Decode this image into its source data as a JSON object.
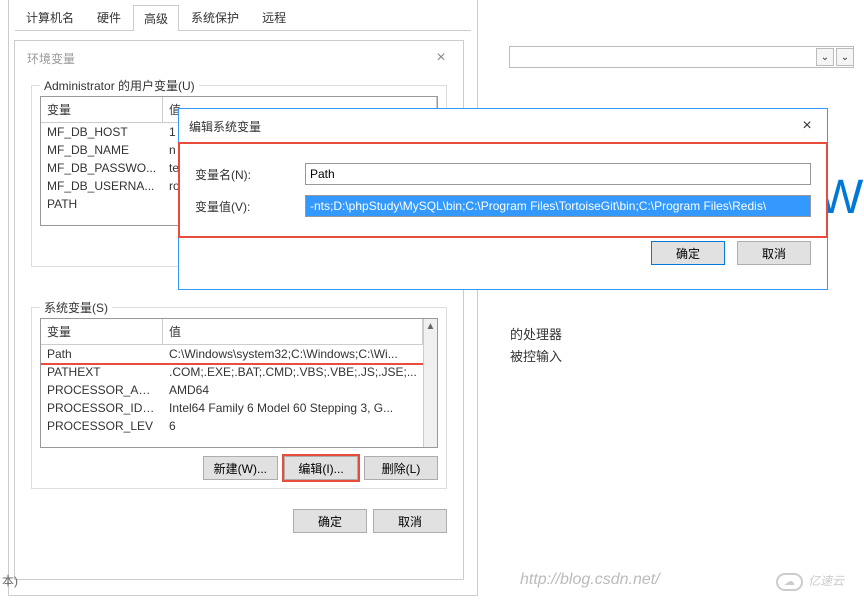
{
  "system_props_tabs": [
    "计算机名",
    "硬件",
    "高级",
    "系统保护",
    "远程"
  ],
  "active_tab_index": 2,
  "env_var_dialog": {
    "title": "环境变量",
    "user_vars": {
      "group_title": "Administrator 的用户变量(U)",
      "headers": {
        "col1": "变量",
        "col2": "值"
      },
      "rows": [
        {
          "name": "MF_DB_HOST",
          "value": "1"
        },
        {
          "name": "MF_DB_NAME",
          "value": "n"
        },
        {
          "name": "MF_DB_PASSWO...",
          "value": "te"
        },
        {
          "name": "MF_DB_USERNA...",
          "value": "ro"
        },
        {
          "name": "PATH",
          "value": ""
        }
      ]
    },
    "system_vars": {
      "group_title": "系统变量(S)",
      "headers": {
        "col1": "变量",
        "col2": "值"
      },
      "rows": [
        {
          "name": "Path",
          "value": "C:\\Windows\\system32;C:\\Windows;C:\\Wi..."
        },
        {
          "name": "PATHEXT",
          "value": ".COM;.EXE;.BAT;.CMD;.VBS;.VBE;.JS;.JSE;..."
        },
        {
          "name": "PROCESSOR_AR...",
          "value": "AMD64"
        },
        {
          "name": "PROCESSOR_IDE...",
          "value": "Intel64 Family 6 Model 60 Stepping 3, G..."
        },
        {
          "name": "PROCESSOR_LEV",
          "value": "6"
        }
      ]
    },
    "buttons": {
      "new": "新建(W)...",
      "edit": "编辑(I)...",
      "delete": "删除(L)",
      "ok": "确定",
      "cancel": "取消"
    }
  },
  "edit_dialog": {
    "title": "编辑系统变量",
    "name_label": "变量名(N):",
    "name_value": "Path",
    "value_label": "变量值(V):",
    "value_value": "-nts;D:\\phpStudy\\MySQL\\bin;C:\\Program Files\\TortoiseGit\\bin;C:\\Program Files\\Redis\\",
    "ok": "确定",
    "cancel": "取消"
  },
  "right_panel": {
    "text1": "的处理器",
    "text2": "被控输入",
    "win_partial": "Wi"
  },
  "watermark": {
    "right": "亿速云",
    "blog": "http://blog.csdn.net/"
  },
  "misc": {
    "bottom_left": "本)"
  }
}
